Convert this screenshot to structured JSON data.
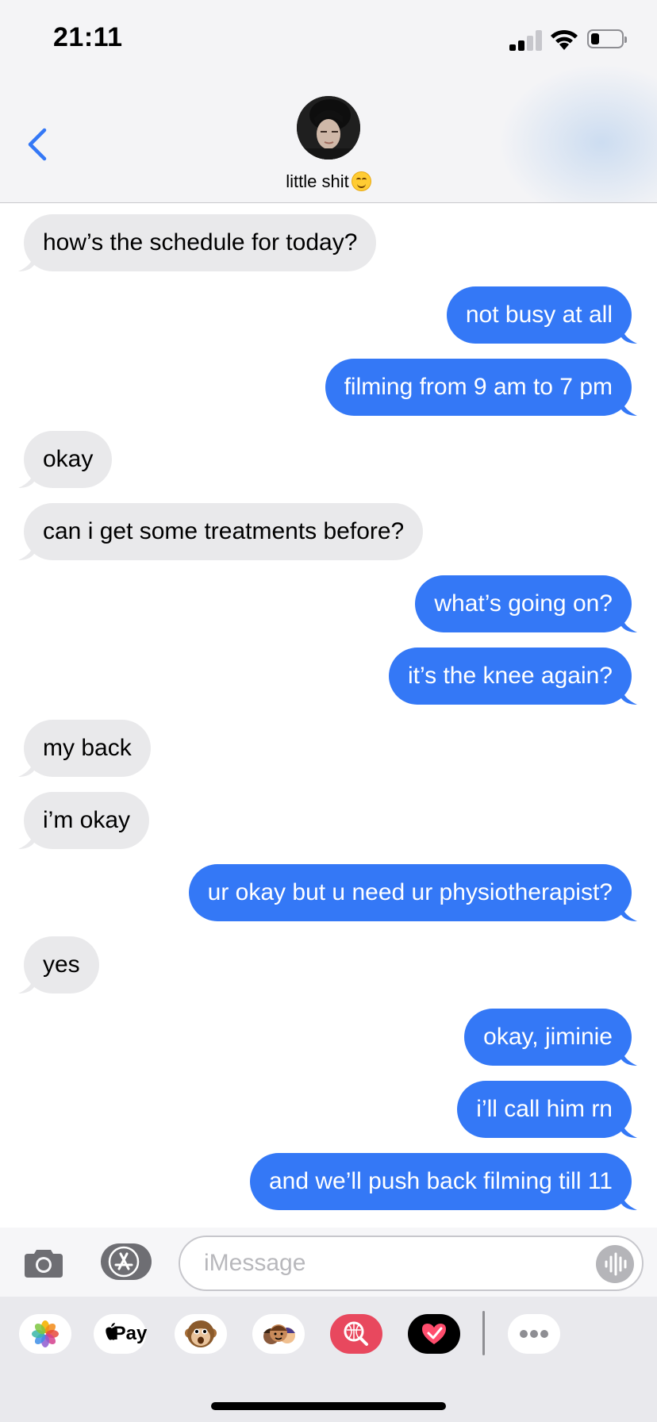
{
  "status_bar": {
    "time": "21:11"
  },
  "header": {
    "contact_name": "little shit"
  },
  "messages": [
    {
      "side": "in",
      "text": "how’s the schedule for today?"
    },
    {
      "side": "out",
      "text": "not busy at all"
    },
    {
      "side": "out",
      "text": "filming from 9 am to 7 pm"
    },
    {
      "side": "in",
      "text": "okay"
    },
    {
      "side": "in",
      "text": "can i get some treatments before?"
    },
    {
      "side": "out",
      "text": "what’s going on?"
    },
    {
      "side": "out",
      "text": "it’s the knee again?"
    },
    {
      "side": "in",
      "text": "my back"
    },
    {
      "side": "in",
      "text": "i’m okay"
    },
    {
      "side": "out",
      "text": "ur okay but u need ur physiotherapist?"
    },
    {
      "side": "in",
      "text": "yes"
    },
    {
      "side": "out",
      "text": "okay, jiminie"
    },
    {
      "side": "out",
      "text": "i’ll call him rn"
    },
    {
      "side": "out",
      "text": "and we’ll push back filming till 11"
    }
  ],
  "composer": {
    "placeholder": "iMessage"
  },
  "app_strip": {
    "apple_pay_label": "Pay",
    "icons": [
      "photos-icon",
      "apple-pay-icon",
      "animoji-icon",
      "memoji-icon",
      "web-search-icon",
      "digital-touch-icon",
      "more-icon"
    ]
  },
  "colors": {
    "outgoing_bubble": "#3478f6",
    "incoming_bubble": "#e9e9eb",
    "accent": "#3478f6"
  }
}
